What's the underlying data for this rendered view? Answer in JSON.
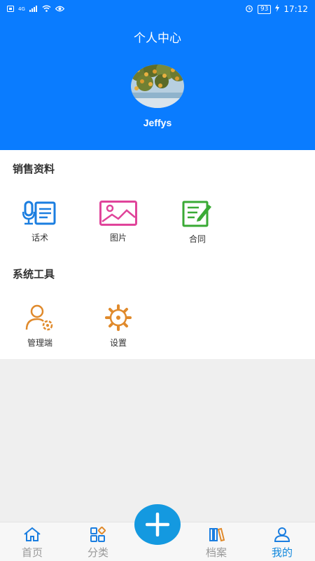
{
  "status_bar": {
    "network": "4G",
    "battery": "93",
    "time": "17:12"
  },
  "header": {
    "title": "个人中心",
    "username": "Jeffys"
  },
  "sections": [
    {
      "title": "销售资料",
      "items": [
        {
          "label": "话术",
          "icon": "microphone-script-icon"
        },
        {
          "label": "图片",
          "icon": "image-icon"
        },
        {
          "label": "合同",
          "icon": "contract-icon"
        }
      ]
    },
    {
      "title": "系统工具",
      "items": [
        {
          "label": "管理端",
          "icon": "admin-user-icon"
        },
        {
          "label": "设置",
          "icon": "gear-icon"
        }
      ]
    }
  ],
  "tabbar": {
    "items": [
      {
        "label": "首页",
        "icon": "home-icon"
      },
      {
        "label": "分类",
        "icon": "category-icon"
      },
      {
        "label": "档案",
        "icon": "archive-icon"
      },
      {
        "label": "我的",
        "icon": "user-icon",
        "active": true
      }
    ],
    "add_icon": "plus-icon"
  },
  "colors": {
    "header_bg": "#0a7cff",
    "blue_icon": "#1b7ee0",
    "pink_icon": "#e0449a",
    "green_icon": "#3aaa35",
    "orange_icon": "#e08a2c",
    "active_tab": "#1188dd",
    "add_button": "#1499e0"
  }
}
